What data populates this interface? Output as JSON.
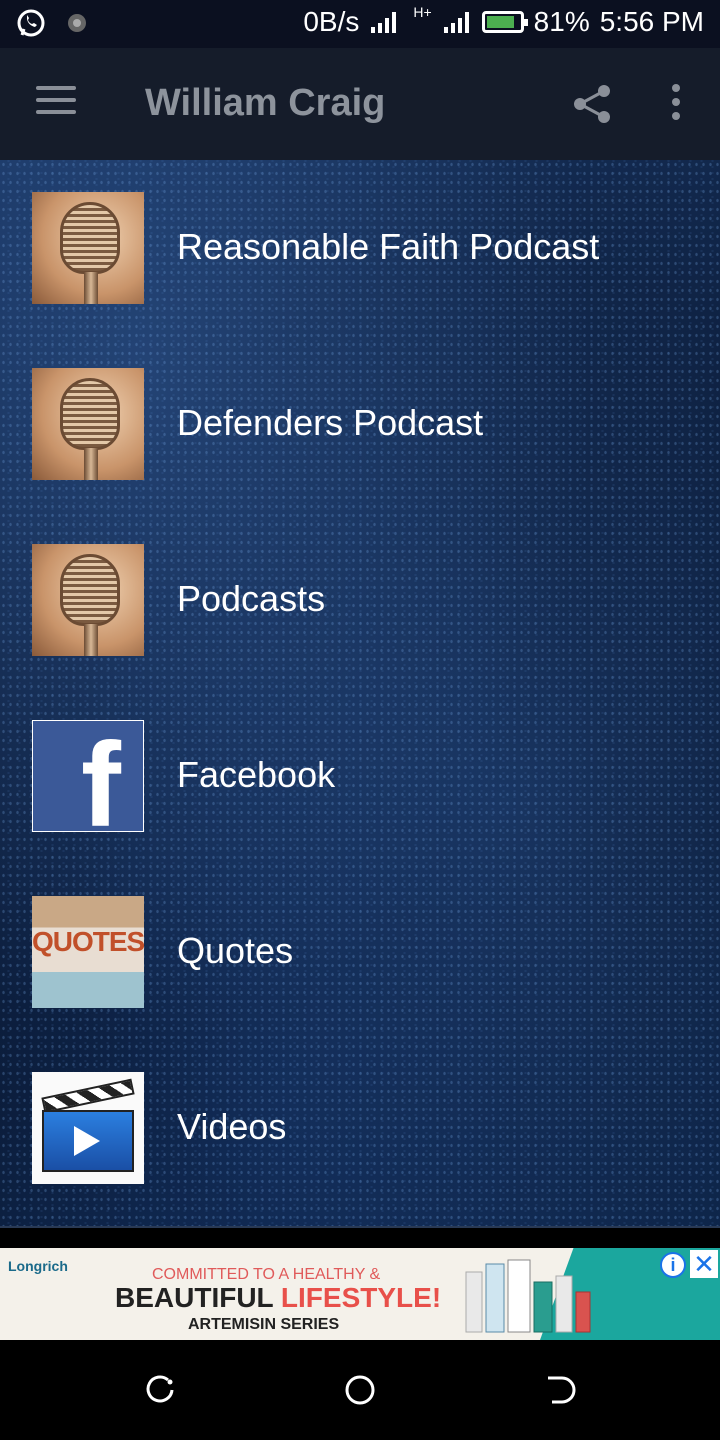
{
  "status_bar": {
    "network_speed": "0B/s",
    "network_type": "H+",
    "battery_percent": "81%",
    "time": "5:56 PM",
    "icons": [
      "whatsapp-icon",
      "notification-dot-icon",
      "signal-icon",
      "battery-icon"
    ]
  },
  "app_bar": {
    "title": "William Craig",
    "icons": [
      "menu-icon",
      "share-icon",
      "more-icon"
    ]
  },
  "menu_items": [
    {
      "label": "Reasonable Faith Podcast",
      "thumbnail": "microphone"
    },
    {
      "label": "Defenders Podcast",
      "thumbnail": "microphone"
    },
    {
      "label": "Podcasts",
      "thumbnail": "microphone"
    },
    {
      "label": "Facebook",
      "thumbnail": "facebook"
    },
    {
      "label": "Quotes",
      "thumbnail": "quotes"
    },
    {
      "label": "Videos",
      "thumbnail": "video-clapper"
    }
  ],
  "ad": {
    "brand": "Longrich",
    "line1": "COMMITTED TO A HEALTHY &",
    "line2_part1": "BEAUTIFUL ",
    "line2_part2": "LIFESTYLE!",
    "line3": "ARTEMISIN SERIES",
    "info_symbol": "i",
    "close_symbol": "✕"
  },
  "colors": {
    "status_bar_bg": "#0b1020",
    "app_bar_bg": "#151c2a",
    "title_color": "#8d939c",
    "content_bg": "#0d1f3e",
    "facebook_blue": "#3b5998",
    "ad_teal": "#1ba79e"
  }
}
